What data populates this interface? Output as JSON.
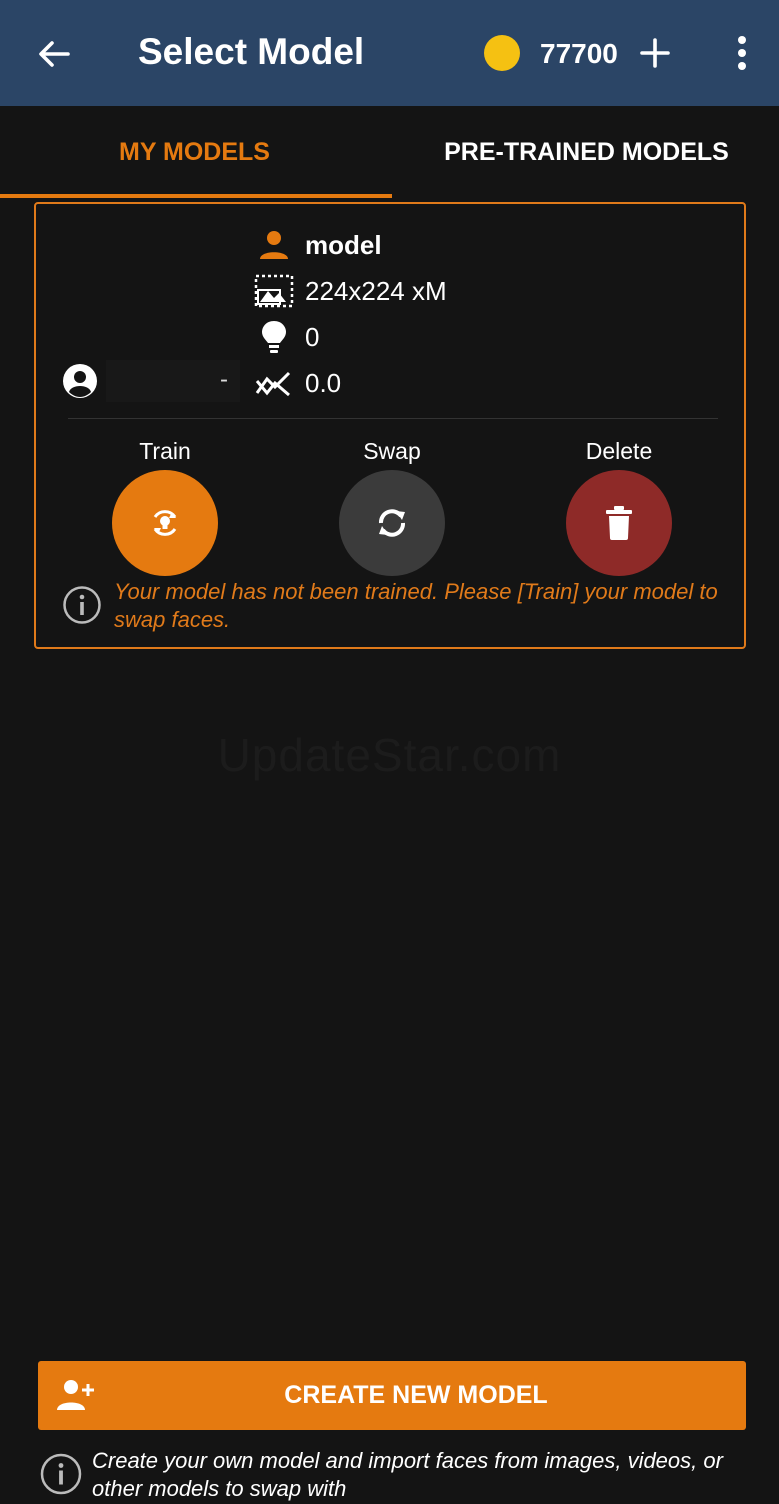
{
  "appbar": {
    "title": "Select Model",
    "credits": "77700",
    "coin_color": "#f5c112",
    "icons": [
      "back-arrow-icon",
      "coin-icon",
      "plus-icon",
      "more-vert-icon"
    ]
  },
  "tabs": [
    {
      "label": "MY MODELS",
      "active": true
    },
    {
      "label": "PRE-TRAINED MODELS",
      "active": false
    }
  ],
  "model_card": {
    "name": "model",
    "resolution": "224x224 xM",
    "trained_count": "0",
    "score": "0.0",
    "owner_placeholder": "-",
    "actions": [
      {
        "label": "Train",
        "color": "#e57a10"
      },
      {
        "label": "Swap",
        "color": "#3b3b3b"
      },
      {
        "label": "Delete",
        "color": "#8e2a28"
      }
    ],
    "warning": "Your model has not been trained. Please [Train] your model to swap faces."
  },
  "watermark": "UpdateStar.com",
  "create_button": {
    "label": "CREATE NEW MODEL",
    "color": "#e57a10"
  },
  "footer_note": "Create your own model and import faces from images, videos, or other models to swap with",
  "colors": {
    "accent": "#e57a10",
    "appbar": "#2b4566",
    "background": "#141414"
  }
}
